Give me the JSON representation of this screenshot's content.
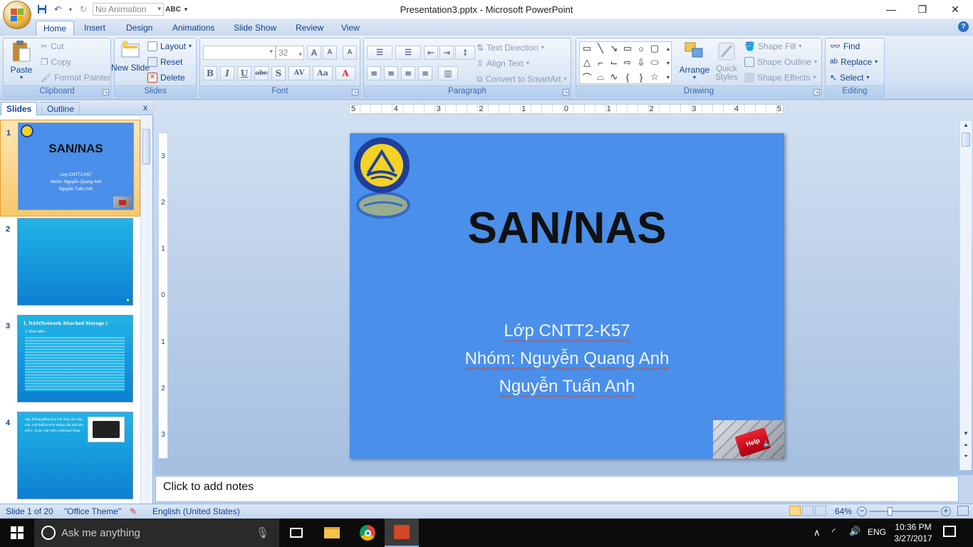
{
  "window": {
    "title": "Presentation3.pptx - Microsoft PowerPoint",
    "minimize": "—",
    "restore": "❐",
    "close": "✕"
  },
  "qat": {
    "animation_value": "No Animation"
  },
  "ribbon": {
    "tabs": [
      "Home",
      "Insert",
      "Design",
      "Animations",
      "Slide Show",
      "Review",
      "View"
    ],
    "clipboard": {
      "paste": "Paste",
      "cut": "Cut",
      "copy": "Copy",
      "format_painter": "Format Painter",
      "label": "Clipboard"
    },
    "slides": {
      "new_slide": "New Slide",
      "layout": "Layout",
      "reset": "Reset",
      "delete": "Delete",
      "label": "Slides"
    },
    "font": {
      "font_name": "",
      "font_size": "32",
      "label": "Font"
    },
    "paragraph": {
      "text_direction": "Text Direction",
      "align_text": "Align Text",
      "convert_smartart": "Convert to SmartArt",
      "label": "Paragraph"
    },
    "drawing": {
      "arrange": "Arrange",
      "quick_styles": "Quick Styles",
      "shape_fill": "Shape Fill",
      "shape_outline": "Shape Outline",
      "shape_effects": "Shape Effects",
      "label": "Drawing"
    },
    "editing": {
      "find": "Find",
      "replace": "Replace",
      "select": "Select",
      "label": "Editing"
    }
  },
  "left_panel": {
    "tabs": [
      "Slides",
      "Outline"
    ],
    "close": "x",
    "slides": [
      {
        "number": "1",
        "title": "SAN/NAS",
        "lines": [
          "Lớp CNTT2-K57",
          "Nhóm: Nguyễn Quang Anh",
          "Nguyễn Tuấn Anh"
        ]
      },
      {
        "number": "2"
      },
      {
        "number": "3",
        "title": "I, NAS(Network Attached Storage )",
        "heading": "1, Khái niệm:"
      },
      {
        "number": "4",
        "text": "Vậy, không giống như một máy chủ máy tính, một thiết bị NAS không cần một bàn phím, chuột, màn hình, keyboard riêng."
      }
    ]
  },
  "ruler": {
    "h_ticks": [
      "5",
      "4",
      "3",
      "2",
      "1",
      "0",
      "1",
      "2",
      "3",
      "4",
      "5"
    ],
    "v_ticks": [
      "3",
      "2",
      "1",
      "0",
      "1",
      "2",
      "3"
    ]
  },
  "slide": {
    "title": "SAN/NAS",
    "line1": "Lớp CNTT2-K57",
    "line2": "Nhóm: Nguyễn Quang Anh",
    "line3": "Nguyễn Tuấn Anh",
    "key_text": "Help"
  },
  "notes": {
    "placeholder": "Click to add notes"
  },
  "status": {
    "slide_pos": "Slide 1 of 20",
    "theme": "\"Office Theme\"",
    "language": "English (United States)",
    "zoom": "64%"
  },
  "taskbar": {
    "search_placeholder": "Ask me anything",
    "lang": "ENG",
    "time": "10:36 PM",
    "date": "3/27/2017"
  },
  "colors": {
    "slide_bg": "#4a8fe9",
    "thumb_bg": "#1ea7e1",
    "accent": "#15428b"
  }
}
